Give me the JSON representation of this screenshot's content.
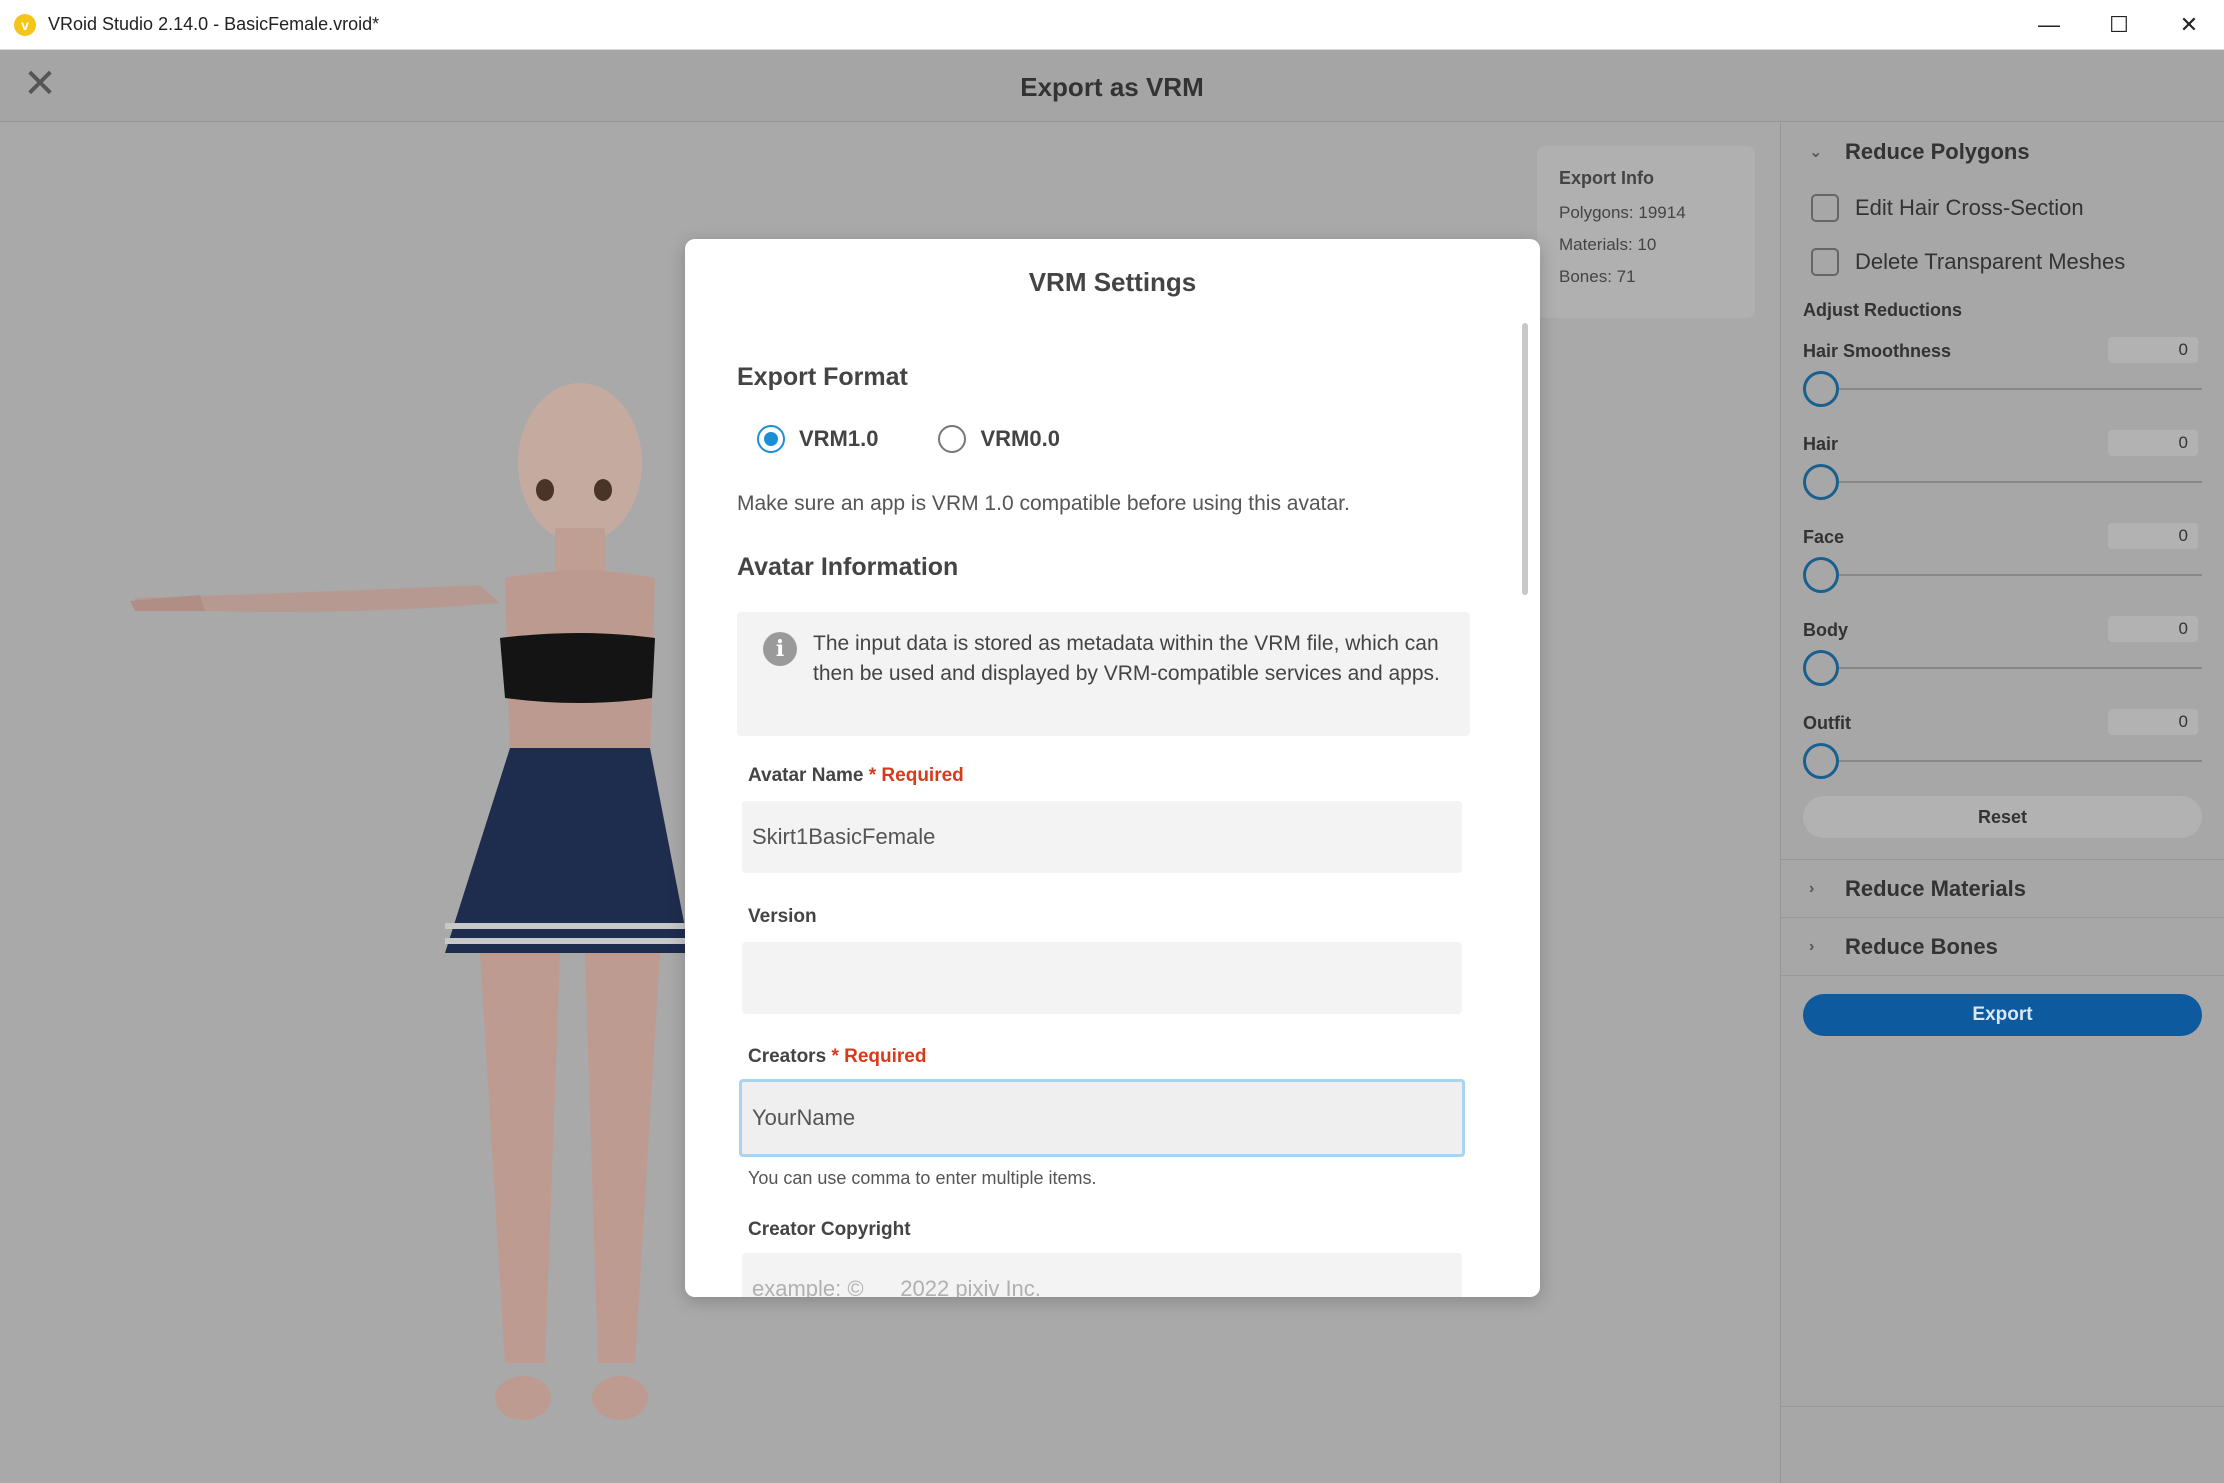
{
  "window": {
    "title": "VRoid Studio 2.14.0 - BasicFemale.vroid*",
    "app_icon": "vroid-logo-icon",
    "minimize": "—",
    "maximize": "☐",
    "close": "✕"
  },
  "header": {
    "title": "Export as VRM",
    "close_icon": "✕"
  },
  "export_info": {
    "title": "Export Info",
    "polygons": "Polygons: 19914",
    "materials": "Materials: 10",
    "bones": "Bones: 71"
  },
  "right_panel": {
    "reduce_polygons": "Reduce Polygons",
    "edit_hair_cross_section": "Edit Hair Cross-Section",
    "delete_transparent_meshes": "Delete Transparent Meshes",
    "adjust_reductions": "Adjust Reductions",
    "sliders": [
      {
        "label": "Hair Smoothness",
        "value": "0"
      },
      {
        "label": "Hair",
        "value": "0"
      },
      {
        "label": "Face",
        "value": "0"
      },
      {
        "label": "Body",
        "value": "0"
      },
      {
        "label": "Outfit",
        "value": "0"
      }
    ],
    "reset": "Reset",
    "reduce_materials": "Reduce Materials",
    "reduce_bones": "Reduce Bones",
    "export": "Export"
  },
  "modal": {
    "title": "VRM Settings",
    "export_format": "Export Format",
    "format_options": [
      "VRM1.0",
      "VRM0.0"
    ],
    "selected_format": "VRM1.0",
    "compat_note": "Make sure an app is VRM 1.0 compatible before using this avatar.",
    "avatar_information": "Avatar Information",
    "info_text": "The input data is stored as metadata within the VRM file, which can then be used and displayed by VRM-compatible services and apps.",
    "avatar_name_label": "Avatar Name",
    "required": "* Required",
    "avatar_name_value": "Skirt1BasicFemale",
    "version_label": "Version",
    "version_value": "",
    "creators_label": "Creators",
    "creators_value": "YourName",
    "creators_helper": "You can use comma to enter multiple items.",
    "copyright_label": "Creator Copyright",
    "copyright_placeholder": "example: ©      2022 pixiv Inc."
  }
}
